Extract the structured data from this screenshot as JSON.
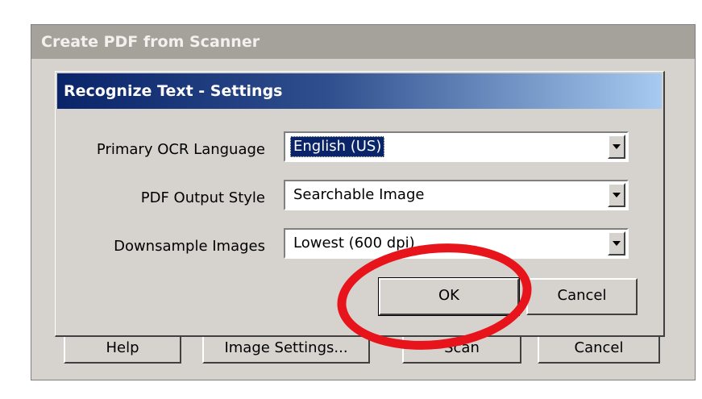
{
  "outer_window": {
    "title": "Create PDF from Scanner",
    "buttons": {
      "help": "Help",
      "image_settings": "Image Settings...",
      "scan": "Scan",
      "cancel": "Cancel"
    }
  },
  "dialog": {
    "title": "Recognize Text - Settings",
    "fields": {
      "ocr_language": {
        "label": "Primary OCR Language",
        "value": "English (US)"
      },
      "output_style": {
        "label": "PDF Output Style",
        "value": "Searchable Image"
      },
      "downsample": {
        "label": "Downsample Images",
        "value": "Lowest (600 dpi)"
      }
    },
    "buttons": {
      "ok": "OK",
      "cancel": "Cancel"
    }
  },
  "annotation": {
    "color": "#e8141b",
    "target": "OK"
  },
  "colors": {
    "titlebar_start": "#0a246a",
    "titlebar_end": "#a6caf0",
    "face": "#d6d3ce"
  }
}
